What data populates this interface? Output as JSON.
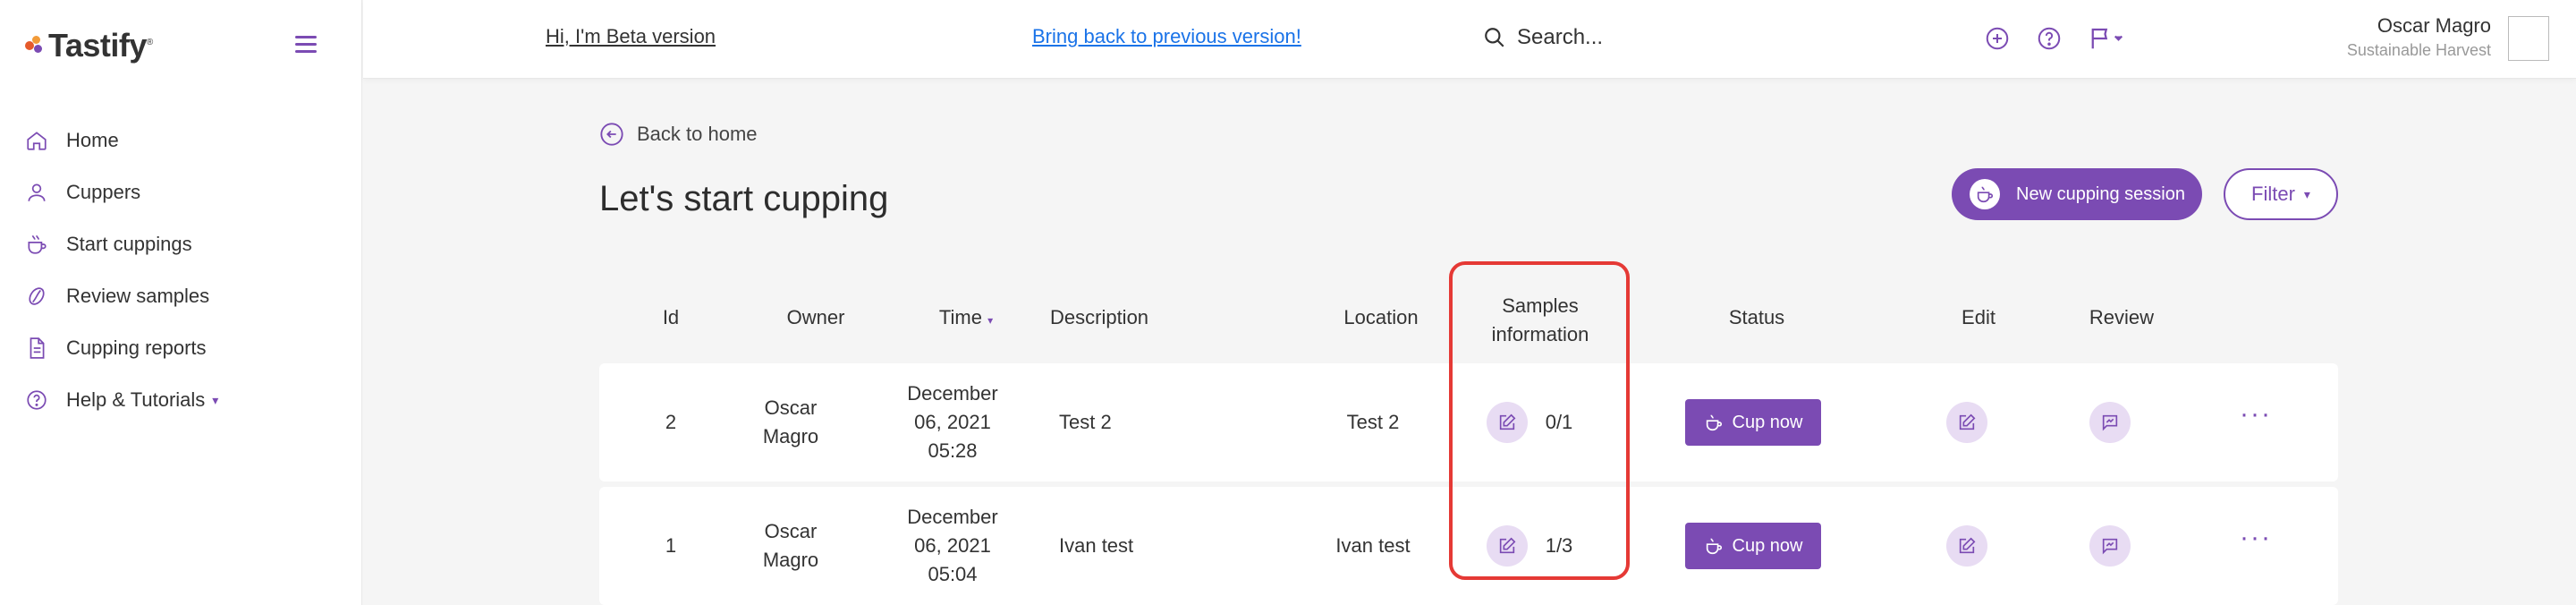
{
  "brand": {
    "name": "Tastify",
    "tm": "®"
  },
  "sidebar": {
    "items": [
      {
        "label": "Home",
        "icon": "home-icon"
      },
      {
        "label": "Cuppers",
        "icon": "user-icon"
      },
      {
        "label": "Start cuppings",
        "icon": "cup-icon"
      },
      {
        "label": "Review samples",
        "icon": "bean-icon"
      },
      {
        "label": "Cupping reports",
        "icon": "document-icon"
      },
      {
        "label": "Help & Tutorials",
        "icon": "question-icon"
      }
    ]
  },
  "header": {
    "beta_text": "Hi, I'm Beta version",
    "bring_back": "Bring back to previous version!",
    "search_placeholder": "Search...",
    "user_name": "Oscar Magro",
    "user_company": "Sustainable Harvest"
  },
  "main": {
    "back_label": "Back to home",
    "title": "Let's start cupping",
    "new_session_label": "New cupping session",
    "filter_label": "Filter"
  },
  "table": {
    "headers": {
      "id": "Id",
      "owner": "Owner",
      "time": "Time",
      "description": "Description",
      "location": "Location",
      "samples_line1": "Samples",
      "samples_line2": "information",
      "status": "Status",
      "edit": "Edit",
      "review": "Review"
    },
    "rows": [
      {
        "id": "2",
        "owner1": "Oscar",
        "owner2": "Magro",
        "date1": "December",
        "date2": "06, 2021",
        "date3": "05:28",
        "description": "Test 2",
        "location": "Test 2",
        "samples": "0/1",
        "status_label": "Cup now"
      },
      {
        "id": "1",
        "owner1": "Oscar",
        "owner2": "Magro",
        "date1": "December",
        "date2": "06, 2021",
        "date3": "05:04",
        "description": "Ivan test",
        "location": "Ivan test",
        "samples": "1/3",
        "status_label": "Cup now"
      }
    ]
  },
  "colors": {
    "accent": "#7b4bb3",
    "accent_light": "#e8dcf3",
    "highlight": "#e53935",
    "link": "#1a73e8"
  }
}
